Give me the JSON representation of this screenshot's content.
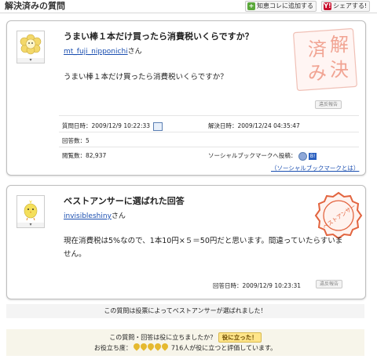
{
  "header": {
    "title": "解決済みの質問",
    "add_chiebukuro": "知恵コレに追加する",
    "share": "シェアする!"
  },
  "question": {
    "title": "うまい棒１本だけ買ったら消費税いくらですか？",
    "user": "mt_fuji_nipponichi",
    "user_suffix": "さん",
    "body": "うまい棒１本だけ買ったら消費税いくらですか？",
    "report_label": "違反報告",
    "stamp_text": "解決済み",
    "asked_label": "質問日時：",
    "asked_value": "2009/12/9 10:22:33",
    "resolved_label": "解決日時：",
    "resolved_value": "2009/12/24 04:35:47",
    "answers_label": "回答数：",
    "answers_value": "5",
    "views_label": "閲覧数：",
    "views_value": "82,937",
    "social_label": "ソーシャルブックマークへ投稿：",
    "social_link": "（ソーシャルブックマークとは）"
  },
  "best_answer": {
    "title": "ベストアンサーに選ばれた回答",
    "user": "invisibleshiny",
    "user_suffix": "さん",
    "body_line1": "現在消費税は5%なので、1本10円×５＝50円だと思います。間違っていたらすいま",
    "body_line2": "せん。",
    "answered_label": "回答日時：",
    "answered_value": "2009/12/9 10:23:31",
    "report_label": "違反報告",
    "stamp_text": "ベストアンサー"
  },
  "vote_note": "この質問は投票によってベストアンサーが選ばれました！",
  "helpful": {
    "question": "この質問・回答は役に立ちましたか？",
    "button": "役に立った！",
    "prefix": "お役立ち度：",
    "count_text": "716人が役に立つと評価しています。"
  }
}
